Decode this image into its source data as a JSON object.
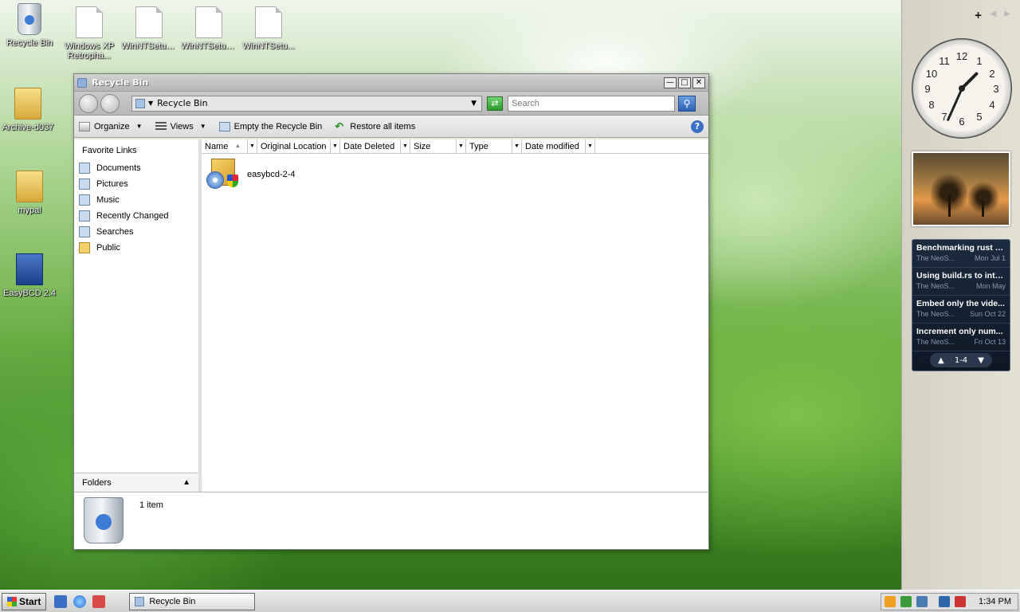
{
  "desktop": {
    "icons": [
      {
        "label": "Recycle Bin"
      },
      {
        "label": "Windows XP Retropha..."
      },
      {
        "label": "WinNTSetup..."
      },
      {
        "label": "WinNTSetup..."
      },
      {
        "label": "WinNTSetu..."
      },
      {
        "label": "Archive-d037"
      },
      {
        "label": "mypal"
      },
      {
        "label": "EasyBCD 2.4"
      }
    ]
  },
  "window": {
    "title": "Recycle Bin",
    "address": "Recycle Bin",
    "search_placeholder": "Search",
    "toolbar": {
      "organize": "Organize",
      "views": "Views",
      "empty": "Empty the Recycle Bin",
      "restore": "Restore all items",
      "help": "?"
    },
    "sidebar": {
      "header": "Favorite Links",
      "links": [
        "Documents",
        "Pictures",
        "Music",
        "Recently Changed",
        "Searches",
        "Public"
      ],
      "folders_label": "Folders"
    },
    "columns": [
      "Name",
      "Original Location",
      "Date Deleted",
      "Size",
      "Type",
      "Date modified"
    ],
    "items": [
      {
        "name": "easybcd-2-4"
      }
    ],
    "details": {
      "count": "1 item"
    }
  },
  "gadgets": {
    "clock_numbers": [
      "12",
      "1",
      "2",
      "3",
      "4",
      "5",
      "6",
      "7",
      "8",
      "9",
      "10",
      "11"
    ],
    "feed": [
      {
        "title": "Benchmarking rust c...",
        "source": "The NeoS...",
        "date": "Mon Jul 1"
      },
      {
        "title": "Using build.rs to inte...",
        "source": "The NeoS...",
        "date": "Mon May"
      },
      {
        "title": "Embed only the vide...",
        "source": "The NeoS...",
        "date": "Sun Oct 22"
      },
      {
        "title": "Increment only num...",
        "source": "The NeoS...",
        "date": "Fri Oct 13"
      }
    ],
    "feed_page": "1-4"
  },
  "taskbar": {
    "start": "Start",
    "task": "Recycle Bin",
    "time": "1:34 PM"
  }
}
